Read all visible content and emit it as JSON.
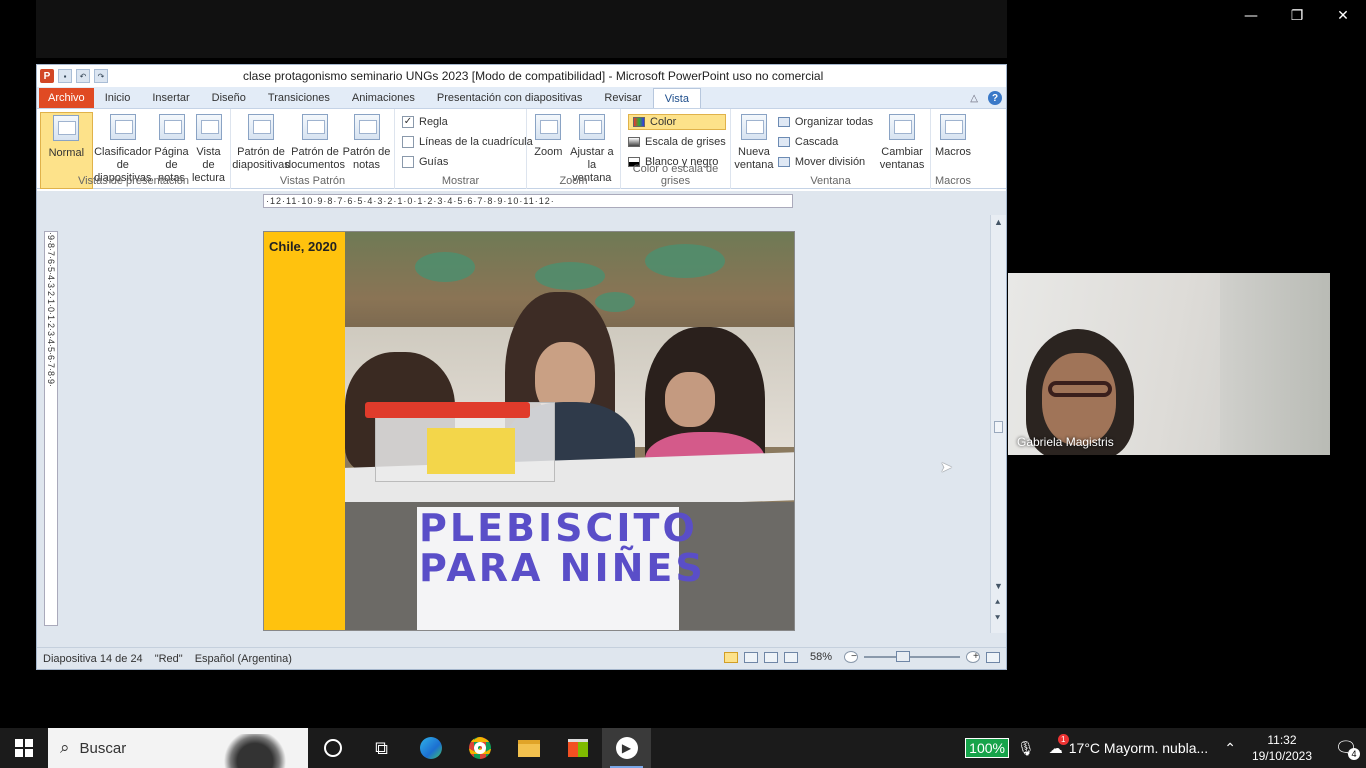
{
  "window_controls": {
    "minimize": "—",
    "restore": "❐",
    "close": "✕"
  },
  "ppt": {
    "title": "clase protagonismo seminario UNGs 2023 [Modo de compatibilidad] - Microsoft PowerPoint uso no comercial",
    "logo": "P",
    "tabs": [
      "Archivo",
      "Inicio",
      "Insertar",
      "Diseño",
      "Transiciones",
      "Animaciones",
      "Presentación con diapositivas",
      "Revisar",
      "Vista"
    ],
    "active_tab": "Vista",
    "ribbon": {
      "vistas_presentacion": {
        "label": "Vistas de presentación",
        "buttons": [
          "Normal",
          "Clasificador de diapositivas",
          "Página de notas",
          "Vista de lectura"
        ]
      },
      "vistas_patron": {
        "label": "Vistas Patrón",
        "buttons": [
          "Patrón de diapositivas",
          "Patrón de documentos",
          "Patrón de notas"
        ]
      },
      "mostrar": {
        "label": "Mostrar",
        "items": [
          {
            "label": "Regla",
            "checked": true
          },
          {
            "label": "Líneas de la cuadrícula",
            "checked": false
          },
          {
            "label": "Guías",
            "checked": false
          }
        ]
      },
      "zoom": {
        "label": "Zoom",
        "buttons": [
          "Zoom",
          "Ajustar a la ventana"
        ]
      },
      "color": {
        "label": "Color o escala de grises",
        "items": [
          "Color",
          "Escala de grises",
          "Blanco y negro"
        ]
      },
      "ventana": {
        "label": "Ventana",
        "new_window": "Nueva ventana",
        "items": [
          "Organizar todas",
          "Cascada",
          "Mover división"
        ],
        "switch": "Cambiar ventanas"
      },
      "macros": {
        "label": "Macros",
        "button": "Macros"
      }
    },
    "ruler_h": "·12·11·10·9·8·7·6·5·4·3·2·1·0·1·2·3·4·5·6·7·8·9·10·11·12·",
    "ruler_v": "·9·8·7·6·5·4·3·2·1·0·1·2·3·4·5·6·7·8·9·",
    "slide": {
      "title": "Chile, 2020",
      "banner_text": "PLEBISCITO PARA NIÑES"
    },
    "status": {
      "slide": "Diapositiva 14 de 24",
      "theme": "\"Red\"",
      "language": "Español (Argentina)",
      "zoom": "58%"
    }
  },
  "participant": {
    "name": "Gabriela Magistris"
  },
  "taskbar": {
    "search_placeholder": "Buscar",
    "battery": "100%",
    "weather": "17°C  Mayorm. nubla...",
    "weather_badge": "1",
    "time": "11:32",
    "date": "19/10/2023",
    "notifications": "4"
  }
}
